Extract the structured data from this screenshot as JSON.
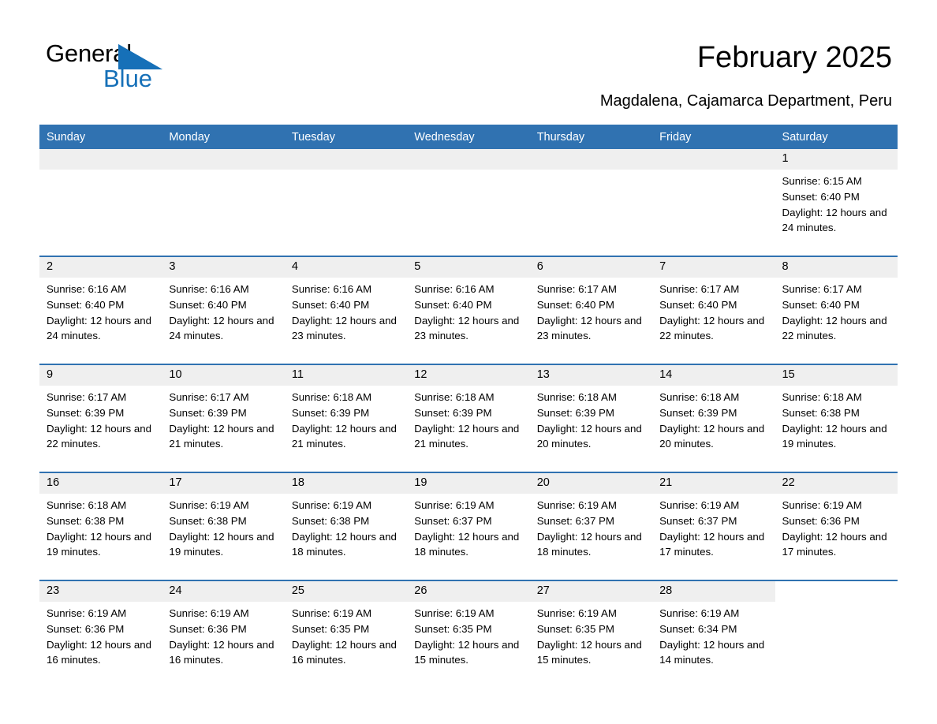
{
  "brand": {
    "name_part1": "General",
    "name_part2": "Blue",
    "triangle_color": "#1670b8",
    "text_color": "#000000"
  },
  "header": {
    "title": "February 2025",
    "subtitle": "Magdalena, Cajamarca Department, Peru"
  },
  "theme": {
    "header_blue": "#3072b1",
    "daynum_gray": "#efefef",
    "cell_white": "#ffffff"
  },
  "calendar": {
    "weekday_headers": [
      "Sunday",
      "Monday",
      "Tuesday",
      "Wednesday",
      "Thursday",
      "Friday",
      "Saturday"
    ],
    "weeks": [
      [
        {
          "type": "blank"
        },
        {
          "type": "blank"
        },
        {
          "type": "blank"
        },
        {
          "type": "blank"
        },
        {
          "type": "blank"
        },
        {
          "type": "blank"
        },
        {
          "type": "day",
          "day": "1",
          "sunrise": "Sunrise: 6:15 AM",
          "sunset": "Sunset: 6:40 PM",
          "daylight": "Daylight: 12 hours and 24 minutes."
        }
      ],
      [
        {
          "type": "day",
          "day": "2",
          "sunrise": "Sunrise: 6:16 AM",
          "sunset": "Sunset: 6:40 PM",
          "daylight": "Daylight: 12 hours and 24 minutes."
        },
        {
          "type": "day",
          "day": "3",
          "sunrise": "Sunrise: 6:16 AM",
          "sunset": "Sunset: 6:40 PM",
          "daylight": "Daylight: 12 hours and 24 minutes."
        },
        {
          "type": "day",
          "day": "4",
          "sunrise": "Sunrise: 6:16 AM",
          "sunset": "Sunset: 6:40 PM",
          "daylight": "Daylight: 12 hours and 23 minutes."
        },
        {
          "type": "day",
          "day": "5",
          "sunrise": "Sunrise: 6:16 AM",
          "sunset": "Sunset: 6:40 PM",
          "daylight": "Daylight: 12 hours and 23 minutes."
        },
        {
          "type": "day",
          "day": "6",
          "sunrise": "Sunrise: 6:17 AM",
          "sunset": "Sunset: 6:40 PM",
          "daylight": "Daylight: 12 hours and 23 minutes."
        },
        {
          "type": "day",
          "day": "7",
          "sunrise": "Sunrise: 6:17 AM",
          "sunset": "Sunset: 6:40 PM",
          "daylight": "Daylight: 12 hours and 22 minutes."
        },
        {
          "type": "day",
          "day": "8",
          "sunrise": "Sunrise: 6:17 AM",
          "sunset": "Sunset: 6:40 PM",
          "daylight": "Daylight: 12 hours and 22 minutes."
        }
      ],
      [
        {
          "type": "day",
          "day": "9",
          "sunrise": "Sunrise: 6:17 AM",
          "sunset": "Sunset: 6:39 PM",
          "daylight": "Daylight: 12 hours and 22 minutes."
        },
        {
          "type": "day",
          "day": "10",
          "sunrise": "Sunrise: 6:17 AM",
          "sunset": "Sunset: 6:39 PM",
          "daylight": "Daylight: 12 hours and 21 minutes."
        },
        {
          "type": "day",
          "day": "11",
          "sunrise": "Sunrise: 6:18 AM",
          "sunset": "Sunset: 6:39 PM",
          "daylight": "Daylight: 12 hours and 21 minutes."
        },
        {
          "type": "day",
          "day": "12",
          "sunrise": "Sunrise: 6:18 AM",
          "sunset": "Sunset: 6:39 PM",
          "daylight": "Daylight: 12 hours and 21 minutes."
        },
        {
          "type": "day",
          "day": "13",
          "sunrise": "Sunrise: 6:18 AM",
          "sunset": "Sunset: 6:39 PM",
          "daylight": "Daylight: 12 hours and 20 minutes."
        },
        {
          "type": "day",
          "day": "14",
          "sunrise": "Sunrise: 6:18 AM",
          "sunset": "Sunset: 6:39 PM",
          "daylight": "Daylight: 12 hours and 20 minutes."
        },
        {
          "type": "day",
          "day": "15",
          "sunrise": "Sunrise: 6:18 AM",
          "sunset": "Sunset: 6:38 PM",
          "daylight": "Daylight: 12 hours and 19 minutes."
        }
      ],
      [
        {
          "type": "day",
          "day": "16",
          "sunrise": "Sunrise: 6:18 AM",
          "sunset": "Sunset: 6:38 PM",
          "daylight": "Daylight: 12 hours and 19 minutes."
        },
        {
          "type": "day",
          "day": "17",
          "sunrise": "Sunrise: 6:19 AM",
          "sunset": "Sunset: 6:38 PM",
          "daylight": "Daylight: 12 hours and 19 minutes."
        },
        {
          "type": "day",
          "day": "18",
          "sunrise": "Sunrise: 6:19 AM",
          "sunset": "Sunset: 6:38 PM",
          "daylight": "Daylight: 12 hours and 18 minutes."
        },
        {
          "type": "day",
          "day": "19",
          "sunrise": "Sunrise: 6:19 AM",
          "sunset": "Sunset: 6:37 PM",
          "daylight": "Daylight: 12 hours and 18 minutes."
        },
        {
          "type": "day",
          "day": "20",
          "sunrise": "Sunrise: 6:19 AM",
          "sunset": "Sunset: 6:37 PM",
          "daylight": "Daylight: 12 hours and 18 minutes."
        },
        {
          "type": "day",
          "day": "21",
          "sunrise": "Sunrise: 6:19 AM",
          "sunset": "Sunset: 6:37 PM",
          "daylight": "Daylight: 12 hours and 17 minutes."
        },
        {
          "type": "day",
          "day": "22",
          "sunrise": "Sunrise: 6:19 AM",
          "sunset": "Sunset: 6:36 PM",
          "daylight": "Daylight: 12 hours and 17 minutes."
        }
      ],
      [
        {
          "type": "day",
          "day": "23",
          "sunrise": "Sunrise: 6:19 AM",
          "sunset": "Sunset: 6:36 PM",
          "daylight": "Daylight: 12 hours and 16 minutes."
        },
        {
          "type": "day",
          "day": "24",
          "sunrise": "Sunrise: 6:19 AM",
          "sunset": "Sunset: 6:36 PM",
          "daylight": "Daylight: 12 hours and 16 minutes."
        },
        {
          "type": "day",
          "day": "25",
          "sunrise": "Sunrise: 6:19 AM",
          "sunset": "Sunset: 6:35 PM",
          "daylight": "Daylight: 12 hours and 16 minutes."
        },
        {
          "type": "day",
          "day": "26",
          "sunrise": "Sunrise: 6:19 AM",
          "sunset": "Sunset: 6:35 PM",
          "daylight": "Daylight: 12 hours and 15 minutes."
        },
        {
          "type": "day",
          "day": "27",
          "sunrise": "Sunrise: 6:19 AM",
          "sunset": "Sunset: 6:35 PM",
          "daylight": "Daylight: 12 hours and 15 minutes."
        },
        {
          "type": "day",
          "day": "28",
          "sunrise": "Sunrise: 6:19 AM",
          "sunset": "Sunset: 6:34 PM",
          "daylight": "Daylight: 12 hours and 14 minutes."
        },
        {
          "type": "void"
        }
      ]
    ]
  }
}
